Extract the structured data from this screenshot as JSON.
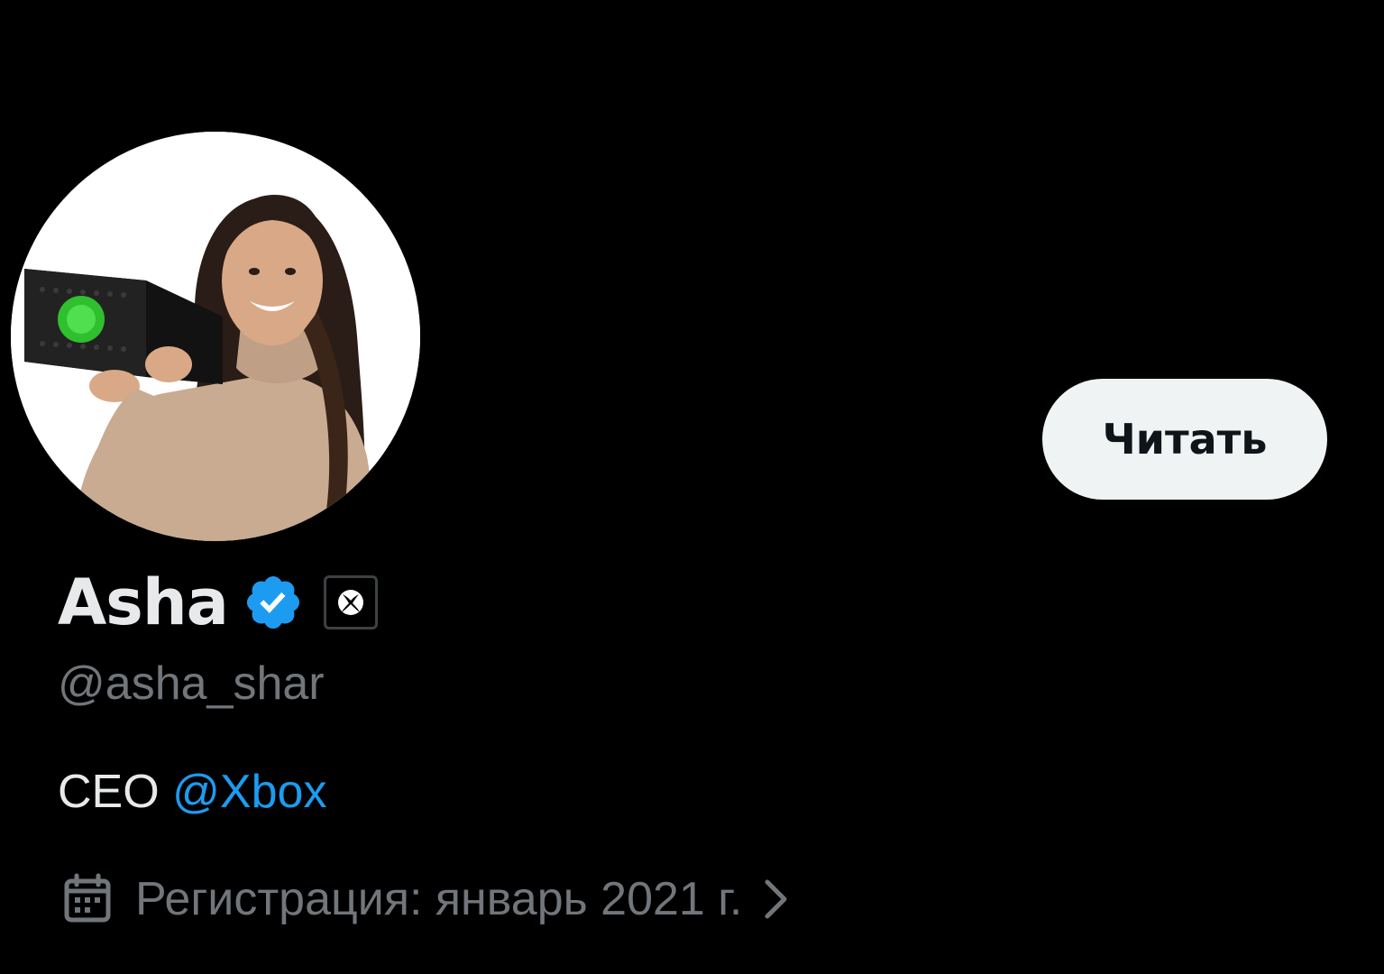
{
  "profile": {
    "display_name": "Asha",
    "handle": "@asha_shar",
    "verified_icon": "verified-badge-icon",
    "affiliate_icon": "xbox-logo-icon",
    "avatar_icon": "avatar-photo"
  },
  "actions": {
    "follow_label": "Читать"
  },
  "bio": {
    "text": "CEO ",
    "mention": "@Xbox"
  },
  "joined": {
    "icon": "calendar-icon",
    "text": "Регистрация: январь 2021 г.",
    "chevron_icon": "chevron-right-icon"
  },
  "colors": {
    "background": "#000000",
    "primary_text": "#e7e9ea",
    "secondary_text": "#71767b",
    "link": "#1d9bf0",
    "verified": "#1d9bf0",
    "button_bg": "#eff3f4",
    "button_text": "#0f1419"
  }
}
